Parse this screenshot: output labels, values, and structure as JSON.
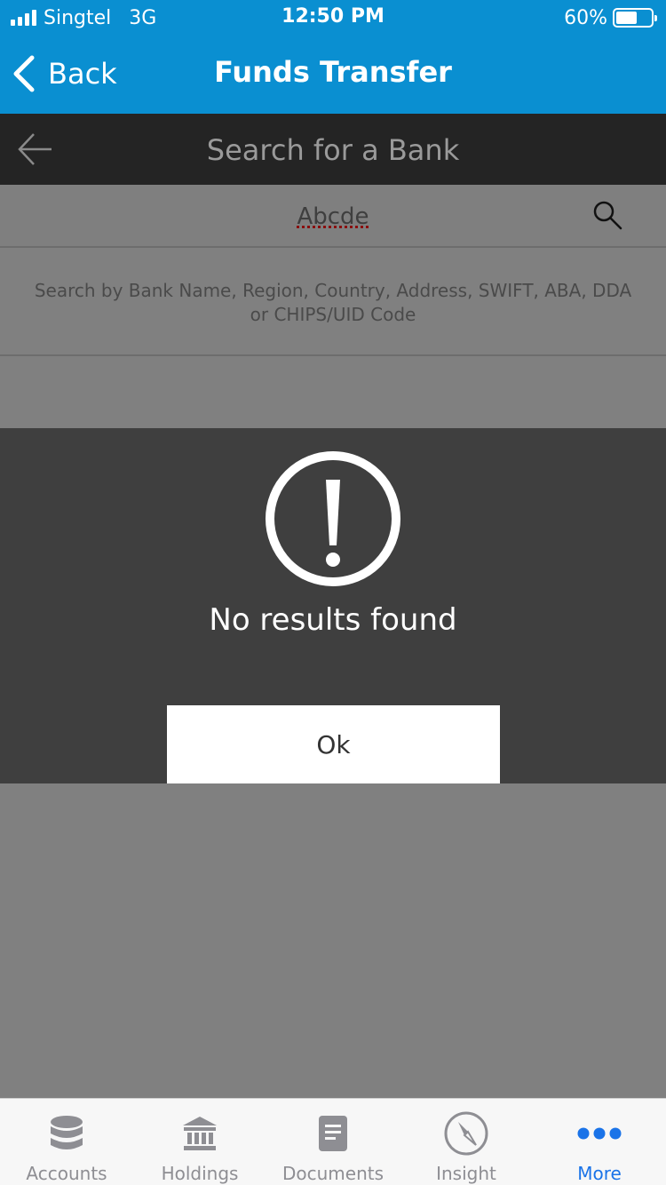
{
  "status_bar": {
    "carrier": "Singtel",
    "network": "3G",
    "time": "12:50 PM",
    "battery": "60%",
    "battery_level": 0.6
  },
  "nav": {
    "back_label": "Back",
    "title": "Funds Transfer"
  },
  "search_header": {
    "title": "Search for a Bank"
  },
  "search": {
    "value": "Abcde",
    "hint": "Search by Bank Name, Region, Country, Address, SWIFT, ABA, DDA or CHIPS/UID Code"
  },
  "modal": {
    "message": "No results found",
    "ok_label": "Ok",
    "icon": "exclamation-circle-icon"
  },
  "tabs": [
    {
      "label": "Accounts",
      "icon": "database-icon"
    },
    {
      "label": "Holdings",
      "icon": "bank-icon"
    },
    {
      "label": "Documents",
      "icon": "document-icon"
    },
    {
      "label": "Insight",
      "icon": "compass-icon"
    },
    {
      "label": "More",
      "icon": "more-icon",
      "active": true
    }
  ],
  "colors": {
    "header_blue": "#0a8fd1",
    "active_tab": "#1a73e8",
    "modal_bg": "#3f3f3f"
  }
}
